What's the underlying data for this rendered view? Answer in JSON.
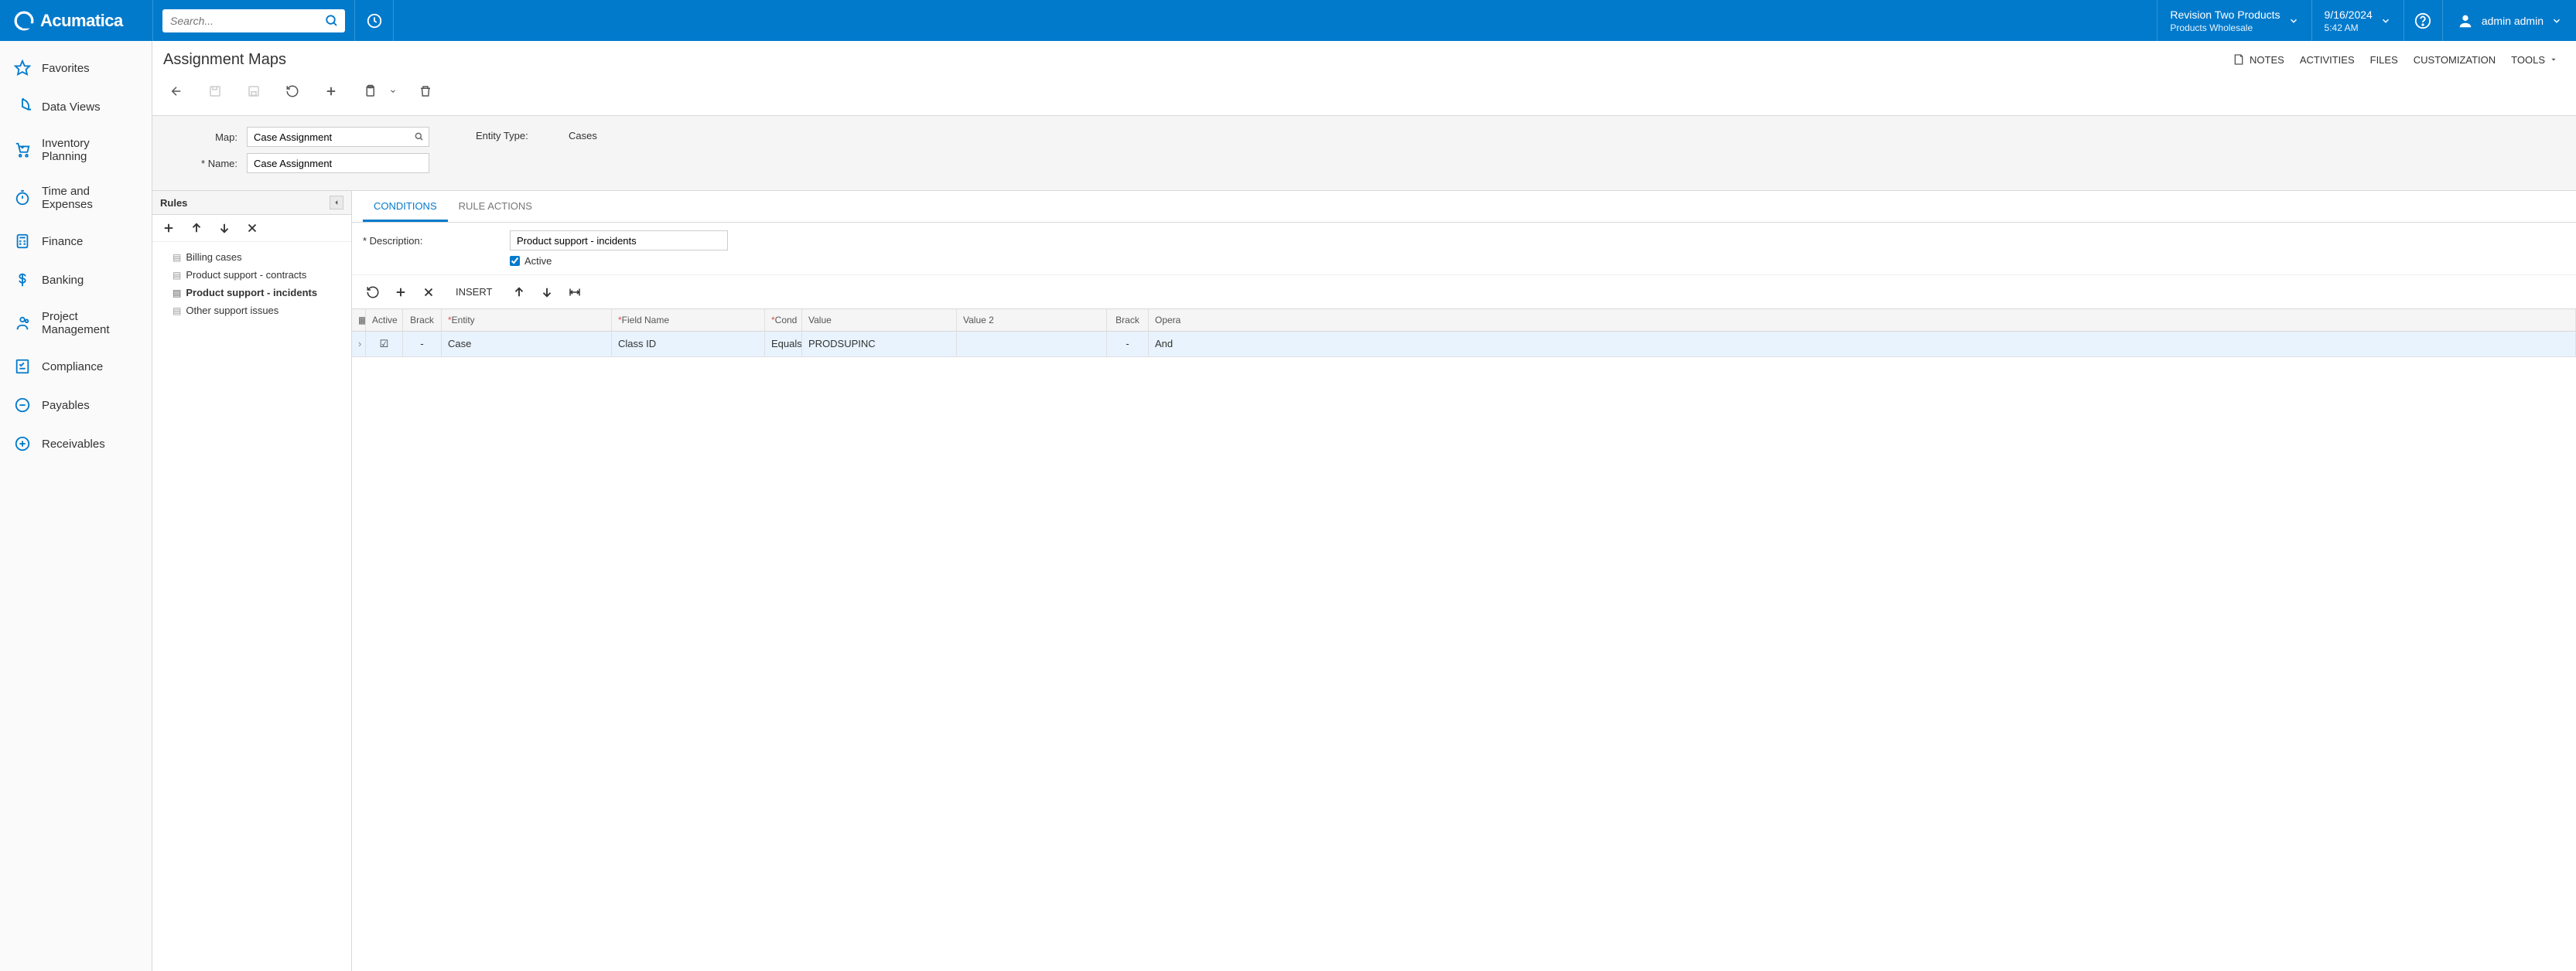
{
  "brand": "Acumatica",
  "search": {
    "placeholder": "Search..."
  },
  "tenant": {
    "name": "Revision Two Products",
    "sub": "Products Wholesale"
  },
  "datetime": {
    "date": "9/16/2024",
    "time": "5:42 AM"
  },
  "user": {
    "name": "admin admin"
  },
  "header_actions": {
    "notes": "NOTES",
    "activities": "ACTIVITIES",
    "files": "FILES",
    "customization": "CUSTOMIZATION",
    "tools": "TOOLS"
  },
  "nav": [
    {
      "label": "Favorites"
    },
    {
      "label": "Data Views"
    },
    {
      "label": "Inventory Planning"
    },
    {
      "label": "Time and Expenses"
    },
    {
      "label": "Finance"
    },
    {
      "label": "Banking"
    },
    {
      "label": "Project Management"
    },
    {
      "label": "Compliance"
    },
    {
      "label": "Payables"
    },
    {
      "label": "Receivables"
    }
  ],
  "page": {
    "title": "Assignment Maps"
  },
  "form": {
    "map_label": "Map:",
    "map_value": "Case Assignment",
    "name_label": "Name:",
    "name_value": "Case Assignment",
    "entity_type_label": "Entity Type:",
    "entity_type_value": "Cases"
  },
  "rules": {
    "title": "Rules",
    "items": [
      {
        "label": "Billing cases"
      },
      {
        "label": "Product support - contracts"
      },
      {
        "label": "Product support - incidents"
      },
      {
        "label": "Other support issues"
      }
    ]
  },
  "tabs": {
    "conditions": "CONDITIONS",
    "rule_actions": "RULE ACTIONS"
  },
  "detail": {
    "description_label": "Description:",
    "description_value": "Product support - incidents",
    "active_label": "Active",
    "active_checked": true
  },
  "grid_toolbar": {
    "insert": "INSERT"
  },
  "grid": {
    "columns": {
      "active": "Active",
      "brack1": "Brack",
      "entity": "Entity",
      "field": "Field Name",
      "cond": "Cond",
      "value": "Value",
      "value2": "Value 2",
      "brack2": "Brack",
      "oper": "Opera"
    },
    "rows": [
      {
        "active": true,
        "brack1": "-",
        "entity": "Case",
        "field": "Class ID",
        "cond": "Equals",
        "value": "PRODSUPINC",
        "value2": "",
        "brack2": "-",
        "oper": "And"
      }
    ]
  }
}
